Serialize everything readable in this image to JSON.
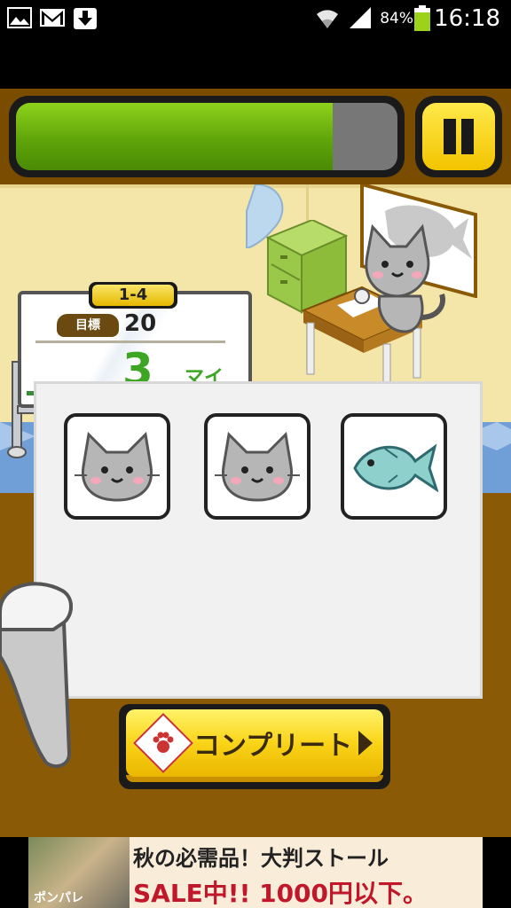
{
  "status_bar": {
    "battery_percent": "84%",
    "time": "16:18",
    "icons": [
      "gallery-icon",
      "gmail-icon",
      "download-icon",
      "wifi-icon",
      "signal-icon",
      "battery-icon"
    ]
  },
  "game": {
    "timer_progress": 0.83,
    "pause_icon": "pause-icon",
    "board": {
      "level": "1-4",
      "goal_label": "目標",
      "goal_value": "20",
      "count": "3",
      "count_unit": "マイ"
    },
    "cards": [
      {
        "icon": "cat-face-icon"
      },
      {
        "icon": "cat-face-icon"
      },
      {
        "icon": "fish-icon"
      }
    ],
    "complete_button": {
      "label": "コンプリート",
      "icon": "paw-icon"
    }
  },
  "ad": {
    "line1": "秋の必需品！大判ストール",
    "line2": "SALE中!! 1000円以下。",
    "brand": "ポンパレ"
  },
  "colors": {
    "progress_green": "#6dbb12",
    "button_yellow": "#f9d418",
    "wood_brown": "#8a5a06",
    "count_green": "#3ca522"
  }
}
